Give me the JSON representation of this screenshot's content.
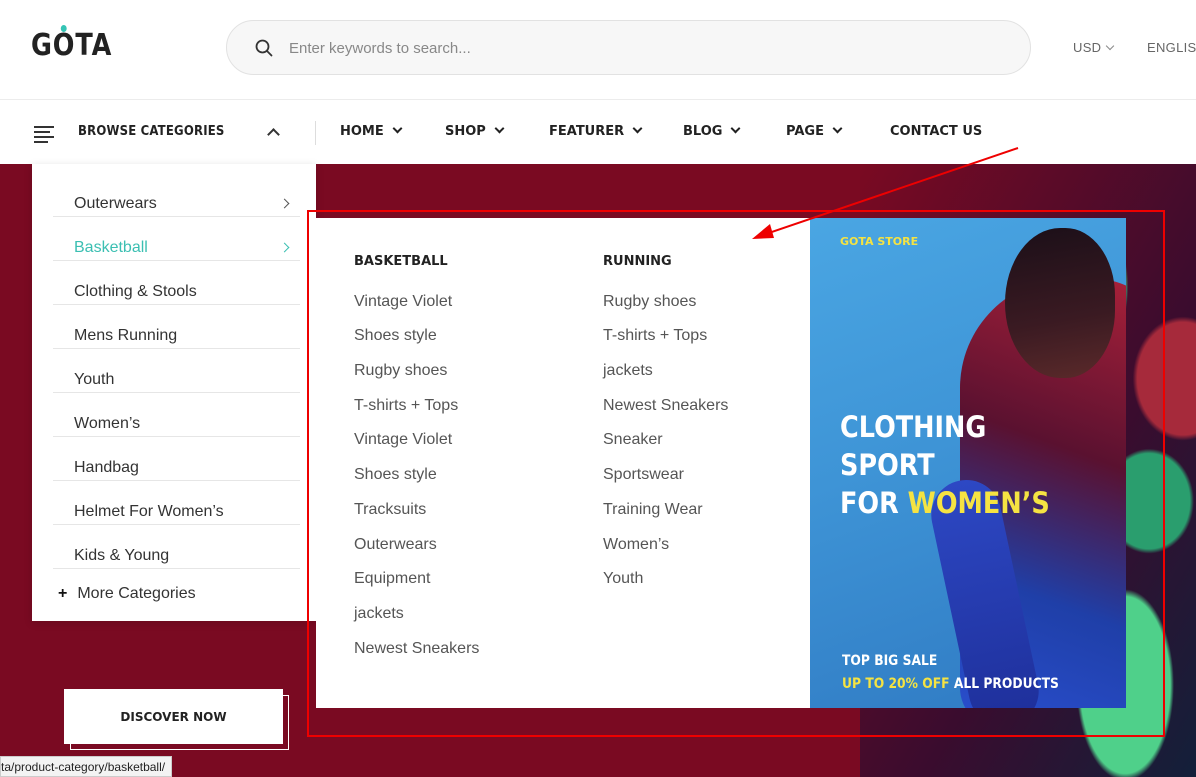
{
  "header": {
    "logo": "GOTA",
    "search_placeholder": "Enter keywords to search...",
    "currency": "USD",
    "language": "ENGLISH"
  },
  "nav": {
    "browse_label": "BROWSE CATEGORIES",
    "items": [
      "HOME",
      "SHOP",
      "FEATURER",
      "BLOG",
      "PAGE",
      "CONTACT US"
    ]
  },
  "sidebar": {
    "categories": [
      "Outerwears",
      "Basketball",
      "Clothing & Stools",
      "Mens Running",
      "Youth",
      "Women’s",
      "Handbag",
      "Helmet For Women’s",
      "Kids & Young"
    ],
    "active": "Basketball",
    "more_label": "More Categories"
  },
  "mega_menu": {
    "col1_title": "BASKETBALL",
    "col1_links": [
      "Vintage Violet",
      "Shoes style",
      "Rugby shoes",
      "T-shirts + Tops",
      "Vintage Violet",
      "Shoes style",
      "Tracksuits",
      "Outerwears",
      "Equipment",
      "jackets",
      "Newest Sneakers"
    ],
    "col2_title": "RUNNING",
    "col2_links": [
      "Rugby shoes",
      "T-shirts + Tops",
      "jackets",
      "Newest Sneakers",
      "Sneaker",
      "Sportswear",
      "Training Wear",
      "Women’s",
      "Youth"
    ],
    "banner": {
      "store": "GOTA STORE",
      "title_line1": "CLOTHING",
      "title_line2": "SPORT",
      "title_line3_prefix": "FOR ",
      "title_line3_highlight": "WOMEN’S",
      "sale_line1": "TOP BIG SALE",
      "sale_highlight": "UP TO 20% OFF",
      "sale_suffix": " ALL PRODUCTS"
    }
  },
  "hero": {
    "button_label": "DISCOVER NOW"
  },
  "status_bar": {
    "url": "ta/product-category/basketball/"
  },
  "colors": {
    "accent": "#3bbfb2",
    "hero_bg": "#7a0a22",
    "highlight_yellow": "#f5e342",
    "annotation_red": "#e00000"
  }
}
